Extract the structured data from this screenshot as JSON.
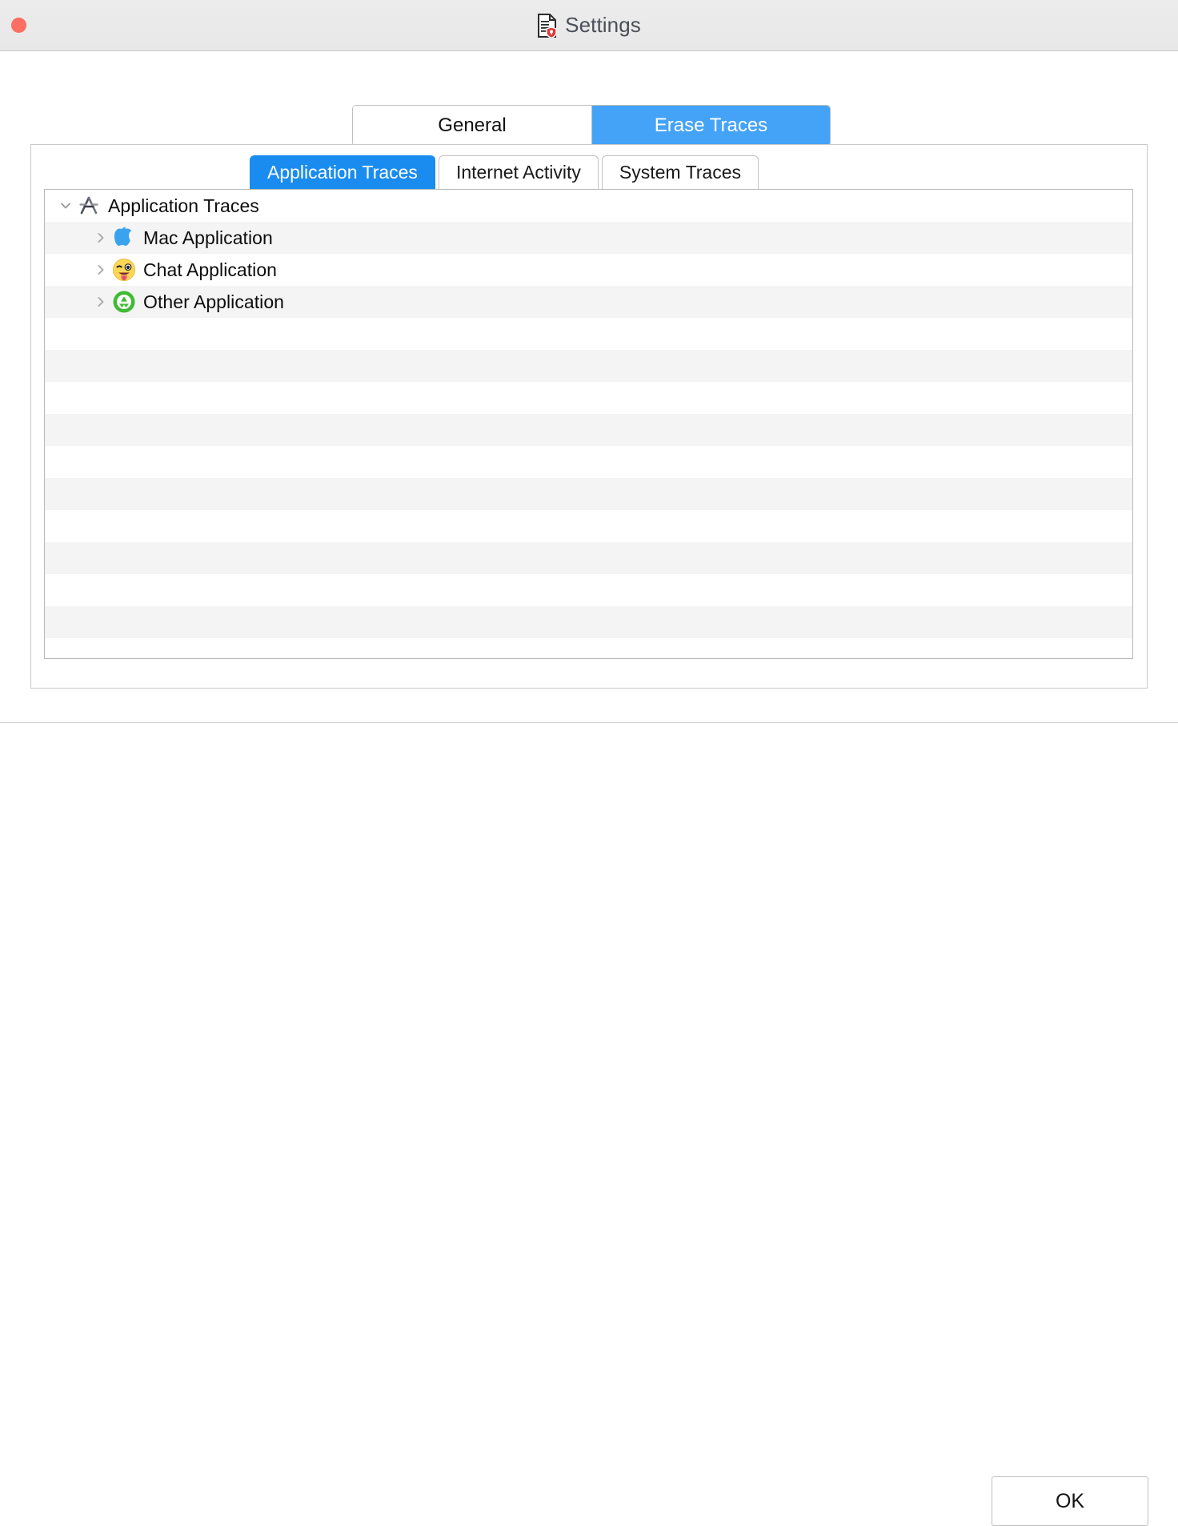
{
  "window": {
    "title": "Settings",
    "title_icon": "document-shield-icon",
    "close_button_label": "Close"
  },
  "segmented_tabs": {
    "items": [
      {
        "label": "General",
        "active": false
      },
      {
        "label": "Erase Traces",
        "active": true
      }
    ]
  },
  "inner_tabs": {
    "items": [
      {
        "label": "Application Traces",
        "active": true
      },
      {
        "label": "Internet Activity",
        "active": false
      },
      {
        "label": "System Traces",
        "active": false
      }
    ]
  },
  "tree": {
    "rows": [
      {
        "label": "Application Traces",
        "icon": "app-store-icon",
        "level": 0,
        "expanded": true,
        "disclosure": "chevron-down-icon"
      },
      {
        "label": "Mac Application",
        "icon": "apple-logo-icon",
        "level": 1,
        "expanded": false,
        "disclosure": "chevron-right-icon"
      },
      {
        "label": "Chat Application",
        "icon": "winking-face-tongue-emoji-icon",
        "level": 1,
        "expanded": false,
        "disclosure": "chevron-right-icon"
      },
      {
        "label": "Other Application",
        "icon": "green-recycle-icon",
        "level": 1,
        "expanded": false,
        "disclosure": "chevron-right-icon"
      }
    ],
    "empty_row_count": 10
  },
  "footer": {
    "ok_label": "OK"
  },
  "colors": {
    "accent_blue": "#1a8cf0",
    "segment_blue": "#44a3f7",
    "close_red": "#fd6f62",
    "row_stripe": "#f4f4f5",
    "titlebar_bg": "#ececec",
    "border_gray": "#c8c8c8"
  }
}
